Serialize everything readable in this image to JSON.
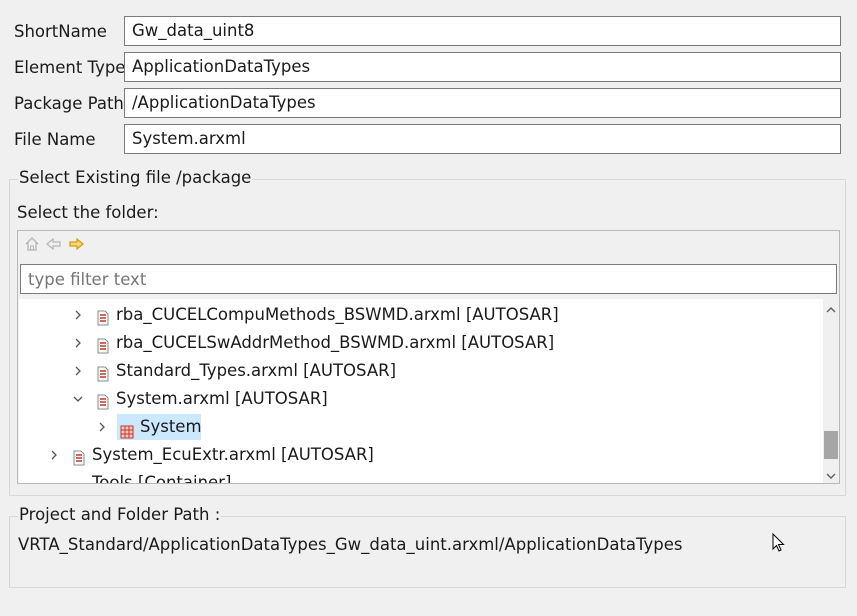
{
  "form": {
    "short_name": {
      "label": "ShortName",
      "value": "Gw_data_uint8"
    },
    "element_type": {
      "label": "Element Type",
      "value": "ApplicationDataTypes"
    },
    "package_path": {
      "label": "Package Path",
      "value": "/ApplicationDataTypes"
    },
    "file_name": {
      "label": "File Name",
      "value": "System.arxml"
    }
  },
  "select_group": {
    "title": "Select Existing file /package",
    "folder_label": "Select the folder:",
    "toolbar": {
      "home_icon": "home-icon",
      "back_icon": "back-arrow-icon",
      "forward_icon": "forward-arrow-icon"
    },
    "filter": {
      "placeholder": "type filter text",
      "value": ""
    },
    "tree": {
      "items": [
        {
          "label": "rba_CUCELCompuMethods_BSWMD.arxml [AUTOSAR]",
          "icon": "arxml-file-icon",
          "expanded": false
        },
        {
          "label": "rba_CUCELSwAddrMethod_BSWMD.arxml [AUTOSAR]",
          "icon": "arxml-file-icon",
          "expanded": false
        },
        {
          "label": "Standard_Types.arxml [AUTOSAR]",
          "icon": "arxml-file-icon",
          "expanded": false
        },
        {
          "label": "System.arxml [AUTOSAR]",
          "icon": "arxml-file-icon",
          "expanded": true
        },
        {
          "label": "System",
          "icon": "package-icon",
          "expanded": false,
          "selected": true
        },
        {
          "label": "System_EcuExtr.arxml [AUTOSAR]",
          "icon": "arxml-file-icon",
          "expanded": false
        },
        {
          "label": "Tools [Container]",
          "icon": "folder-icon",
          "expanded": false
        }
      ]
    }
  },
  "path_group": {
    "title": "Project and Folder Path :",
    "value": "VRTA_Standard/ApplicationDataTypes_Gw_data_uint.arxml/ApplicationDataTypes"
  },
  "colors": {
    "selection": "#cce8ff",
    "forward_arrow": "#e8b21a",
    "file_icon_red": "#c0392b"
  }
}
